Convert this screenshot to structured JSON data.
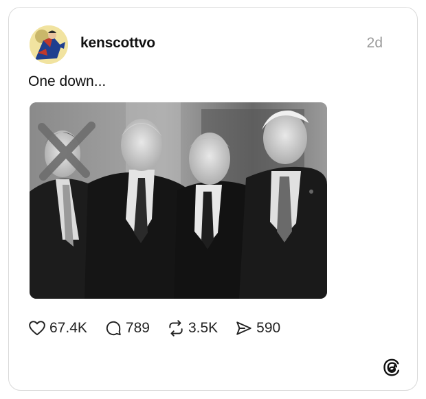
{
  "post": {
    "username": "kenscottvo",
    "time": "2d",
    "text": "One down...",
    "avatar_icon": "superhero-avatar-icon",
    "image_icon": "group-photo-image"
  },
  "actions": {
    "likes": "67.4K",
    "replies": "789",
    "reposts": "3.5K",
    "shares": "590"
  },
  "icons": {
    "like": "heart-icon",
    "reply": "speech-bubble-icon",
    "repost": "repost-arrows-icon",
    "share": "paper-plane-icon",
    "brand": "threads-logo-icon"
  },
  "colors": {
    "border": "#d9d9d9",
    "muted_text": "#9a9a9a",
    "cross_mark": "#6e6e6e"
  }
}
